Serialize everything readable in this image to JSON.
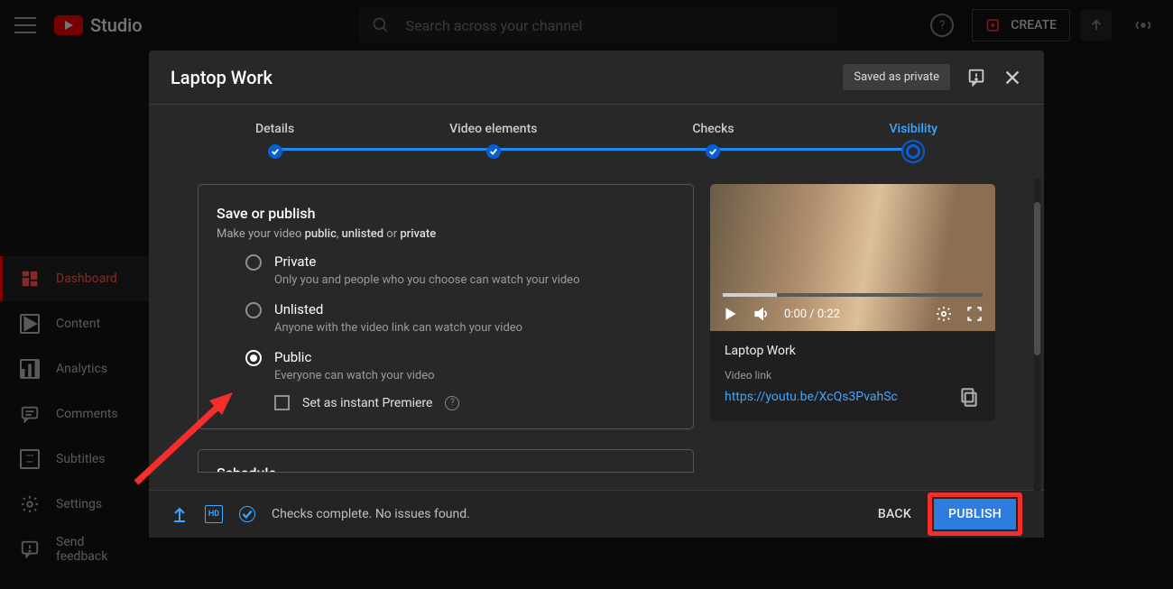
{
  "app": {
    "studio_label": "Studio"
  },
  "search": {
    "placeholder": "Search across your channel"
  },
  "create_label": "CREATE",
  "sidebar": {
    "items": [
      {
        "label": "Dashboard"
      },
      {
        "label": "Content"
      },
      {
        "label": "Analytics"
      },
      {
        "label": "Comments"
      },
      {
        "label": "Subtitles"
      },
      {
        "label": "Settings"
      },
      {
        "label": "Send feedback"
      }
    ]
  },
  "dialog": {
    "title": "Laptop Work",
    "saved_badge": "Saved as private",
    "steps": [
      "Details",
      "Video elements",
      "Checks",
      "Visibility"
    ],
    "card": {
      "title": "Save or publish",
      "subtitle_prefix": "Make your video ",
      "subtitle_b1": "public",
      "subtitle_sep": ", ",
      "subtitle_b2": "unlisted",
      "subtitle_or": " or ",
      "subtitle_b3": "private"
    },
    "options": [
      {
        "title": "Private",
        "desc": "Only you and people who you choose can watch your video"
      },
      {
        "title": "Unlisted",
        "desc": "Anyone with the video link can watch your video"
      },
      {
        "title": "Public",
        "desc": "Everyone can watch your video"
      }
    ],
    "premiere_label": "Set as instant Premiere",
    "schedule_title": "Schedule",
    "preview": {
      "time": "0:00 / 0:22",
      "title": "Laptop Work",
      "link_label": "Video link",
      "link": "https://youtu.be/XcQs3PvahSc"
    },
    "footer": {
      "status": "Checks complete. No issues found.",
      "back": "BACK",
      "publish": "PUBLISH",
      "hd": "HD"
    }
  }
}
